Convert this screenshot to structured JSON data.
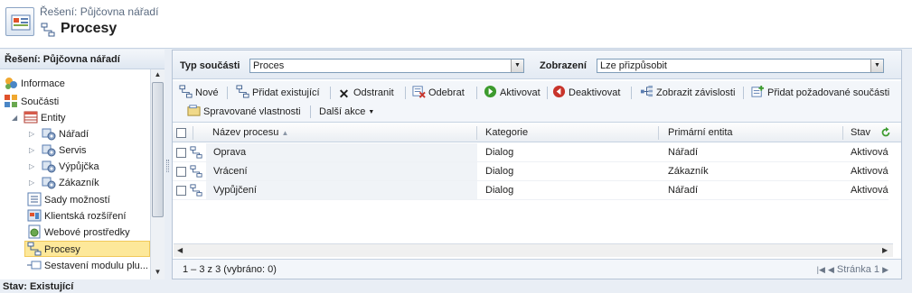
{
  "header": {
    "subtitle": "Řešení: Půjčovna nářadí",
    "title": "Procesy"
  },
  "nav": {
    "heading": "Řešení: Půjčovna nářadí",
    "items": [
      {
        "label": "Informace",
        "icon": "information-icon"
      },
      {
        "label": "Součásti",
        "icon": "components-icon"
      },
      {
        "label": "Entity",
        "icon": "entities-icon"
      },
      {
        "label": "Nářadí",
        "icon": "entity-gear-icon"
      },
      {
        "label": "Servis",
        "icon": "entity-gear-icon"
      },
      {
        "label": "Výpůjčka",
        "icon": "entity-gear-icon"
      },
      {
        "label": "Zákazník",
        "icon": "entity-gear-icon"
      },
      {
        "label": "Sady možností",
        "icon": "option-sets-icon"
      },
      {
        "label": "Klientská rozšíření",
        "icon": "client-extensions-icon"
      },
      {
        "label": "Webové prostředky",
        "icon": "web-resources-icon"
      },
      {
        "label": "Procesy",
        "icon": "process-icon"
      },
      {
        "label": "Sestavení modulu plu...",
        "icon": "plugin-assembly-icon"
      }
    ]
  },
  "filters": {
    "component_type_label": "Typ součásti",
    "component_type_value": "Proces",
    "view_label": "Zobrazení",
    "view_value": "Lze přizpůsobit"
  },
  "toolbar": {
    "new": "Nové",
    "add_existing": "Přidat existující",
    "remove": "Odstranit",
    "deleted": "Odebrat",
    "activate": "Aktivovat",
    "deactivate": "Deaktivovat",
    "show_dependencies": "Zobrazit závislosti",
    "add_required": "Přidat požadované součásti",
    "managed_props": "Spravované vlastnosti",
    "more_actions": "Další akce"
  },
  "grid": {
    "columns": [
      "Název procesu",
      "Kategorie",
      "Primární entita",
      "Stav"
    ],
    "rows": [
      {
        "name": "Oprava",
        "category": "Dialog",
        "entity": "Nářadí",
        "status": "Aktivován"
      },
      {
        "name": "Vrácení",
        "category": "Dialog",
        "entity": "Zákazník",
        "status": "Aktivován"
      },
      {
        "name": "Vypůjčení",
        "category": "Dialog",
        "entity": "Nářadí",
        "status": "Aktivován"
      }
    ],
    "record_count": "1 – 3  z 3 (vybráno: 0)",
    "page": "Stránka 1"
  },
  "status": {
    "text": "Stav: Existující"
  },
  "colors": {
    "selection": "#fde89a",
    "header_blue": "#dfe7f1",
    "activate_green": "#3c9b2e",
    "deactivate_red": "#c8342b"
  }
}
